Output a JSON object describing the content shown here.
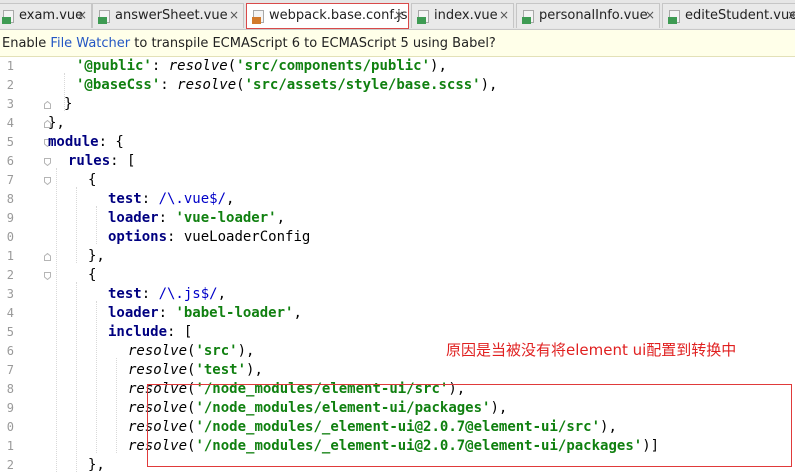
{
  "tabs": [
    {
      "label": "exam.vue",
      "type": "vue",
      "active": false
    },
    {
      "label": "answerSheet.vue",
      "type": "vue",
      "active": false
    },
    {
      "label": "webpack.base.conf.js",
      "type": "js",
      "active": true
    },
    {
      "label": "index.vue",
      "type": "vue",
      "active": false
    },
    {
      "label": "personalInfo.vue",
      "type": "vue",
      "active": false
    },
    {
      "label": "editeStudent.vue",
      "type": "vue",
      "active": false
    }
  ],
  "notice": {
    "prefix": "Enable ",
    "link": "File Watcher",
    "suffix": " to transpile ECMAScript 6 to ECMAScript 5 using Babel?"
  },
  "gutter": {
    "line_numbers": [
      "1",
      "2",
      "3",
      "4",
      "5",
      "6",
      "7",
      "8",
      "9",
      "0",
      "1",
      "2",
      "3",
      "4",
      "5",
      "6",
      "7",
      "8",
      "9",
      "0",
      "1",
      "2"
    ]
  },
  "code_lines": [
    [
      [
        "s",
        "'@public'"
      ],
      [
        "p",
        ": "
      ],
      [
        "f",
        "resolve"
      ],
      [
        "p",
        "("
      ],
      [
        "s",
        "'src/components/public'"
      ],
      [
        "p",
        "),"
      ]
    ],
    [
      [
        "s",
        "'@baseCss'"
      ],
      [
        "p",
        ": "
      ],
      [
        "f",
        "resolve"
      ],
      [
        "p",
        "("
      ],
      [
        "s",
        "'src/assets/style/base.scss'"
      ],
      [
        "p",
        "),"
      ]
    ],
    [
      [
        "p",
        "}"
      ]
    ],
    [
      [
        "p",
        "},"
      ]
    ],
    [
      [
        "k",
        "module"
      ],
      [
        "p",
        ": {"
      ]
    ],
    [
      [
        "k",
        "rules"
      ],
      [
        "p",
        ": ["
      ]
    ],
    [
      [
        "p",
        "{"
      ]
    ],
    [
      [
        "k",
        "test"
      ],
      [
        "p",
        ": "
      ],
      [
        "r",
        "/\\.vue$/"
      ],
      [
        "p",
        ","
      ]
    ],
    [
      [
        "k",
        "loader"
      ],
      [
        "p",
        ": "
      ],
      [
        "s",
        "'vue-loader'"
      ],
      [
        "p",
        ","
      ]
    ],
    [
      [
        "k",
        "options"
      ],
      [
        "p",
        ": vueLoaderConfig"
      ]
    ],
    [
      [
        "p",
        "},"
      ]
    ],
    [
      [
        "p",
        "{"
      ]
    ],
    [
      [
        "k",
        "test"
      ],
      [
        "p",
        ": "
      ],
      [
        "r",
        "/\\.js$/"
      ],
      [
        "p",
        ","
      ]
    ],
    [
      [
        "k",
        "loader"
      ],
      [
        "p",
        ": "
      ],
      [
        "s",
        "'babel-loader'"
      ],
      [
        "p",
        ","
      ]
    ],
    [
      [
        "k",
        "include"
      ],
      [
        "p",
        ": ["
      ]
    ],
    [
      [
        "f",
        "resolve"
      ],
      [
        "p",
        "("
      ],
      [
        "s",
        "'src'"
      ],
      [
        "p",
        "),"
      ]
    ],
    [
      [
        "f",
        "resolve"
      ],
      [
        "p",
        "("
      ],
      [
        "s",
        "'test'"
      ],
      [
        "p",
        "),"
      ]
    ],
    [
      [
        "f",
        "resolve"
      ],
      [
        "p",
        "("
      ],
      [
        "s",
        "'/node_modules/element-ui/src'"
      ],
      [
        "p",
        "),"
      ]
    ],
    [
      [
        "f",
        "resolve"
      ],
      [
        "p",
        "("
      ],
      [
        "s",
        "'/node_modules/element-ui/packages'"
      ],
      [
        "p",
        "),"
      ]
    ],
    [
      [
        "f",
        "resolve"
      ],
      [
        "p",
        "("
      ],
      [
        "s",
        "'/node_modules/_element-ui@2.0.7@element-ui/src'"
      ],
      [
        "p",
        "),"
      ]
    ],
    [
      [
        "f",
        "resolve"
      ],
      [
        "p",
        "("
      ],
      [
        "s",
        "'/node_modules/_element-ui@2.0.7@element-ui/packages'"
      ],
      [
        "p",
        ")]"
      ]
    ],
    [
      [
        "p",
        "},"
      ]
    ]
  ],
  "annotation": {
    "text": "原因是当被没有将element ui配置到转换中",
    "color": "#e02020"
  },
  "colors": {
    "string": "#108010",
    "keyword": "#000080",
    "regex": "#0000c8",
    "annotation_border": "#e03a3a",
    "active_tab_border": "#d94a4a"
  }
}
